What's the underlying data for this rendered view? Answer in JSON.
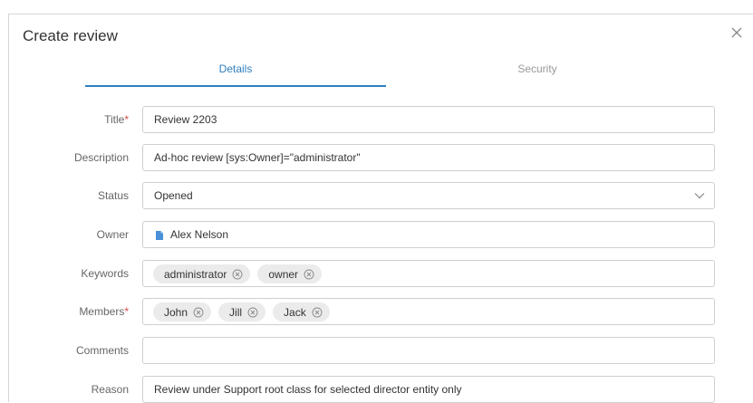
{
  "dialog": {
    "title": "Create review"
  },
  "tabs": [
    {
      "label": "Details",
      "active": true
    },
    {
      "label": "Security",
      "active": false
    }
  ],
  "form": {
    "title": {
      "label": "Title",
      "required_mark": "*",
      "value": "Review 2203"
    },
    "description": {
      "label": "Description",
      "value": "Ad-hoc review [sys:Owner]=\"administrator\""
    },
    "status": {
      "label": "Status",
      "value": "Opened"
    },
    "owner": {
      "label": "Owner",
      "value": "Alex Nelson",
      "icon": "document-icon"
    },
    "keywords": {
      "label": "Keywords",
      "chips": [
        "administrator",
        "owner"
      ]
    },
    "members": {
      "label": "Members",
      "required_mark": "*",
      "chips": [
        "John",
        "Jill",
        "Jack"
      ]
    },
    "comments": {
      "label": "Comments",
      "value": ""
    },
    "reason": {
      "label": "Reason",
      "value": "Review under Support root class for selected director entity only"
    }
  },
  "colors": {
    "accent": "#2f7fbf",
    "required": "#e04848",
    "chip_bg": "#ebebeb"
  }
}
